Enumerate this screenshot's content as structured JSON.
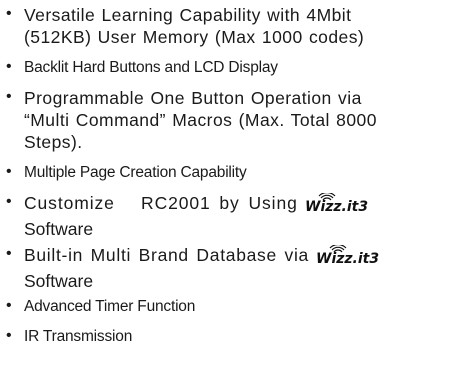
{
  "features": {
    "item1": {
      "line1": "Versatile Learning Capability with 4Mbit",
      "line2": "(512KB) User Memory (Max 1000 codes)"
    },
    "item2": {
      "line1": "Backlit Hard Buttons and LCD Display"
    },
    "item3": {
      "line1": "Programmable One Button Operation via",
      "line2": "“Multi Command” Macros (Max. Total 8000",
      "line3": "Steps)."
    },
    "item4": {
      "line1": "Multiple Page Creation Capability"
    },
    "item5": {
      "line1": "Customize   RC2001 by Using",
      "line2": "Software"
    },
    "item6": {
      "line1": "Built-in Multi Brand Database via",
      "line2": "Software"
    },
    "item7": {
      "line1": "Advanced Timer Function"
    },
    "item8": {
      "line1": "IR Transmission"
    },
    "bullet": "•",
    "logo_text": "Wizz.it3"
  }
}
